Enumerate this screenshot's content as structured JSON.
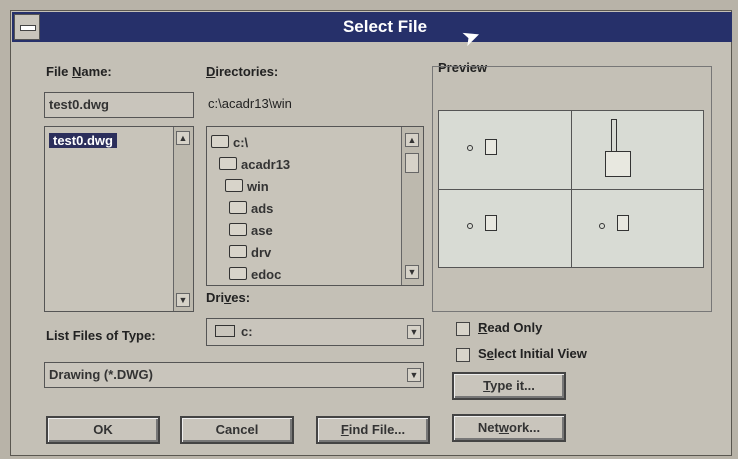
{
  "window": {
    "title": "Select File"
  },
  "file_name": {
    "label_pre": "File ",
    "label_u": "N",
    "label_post": "ame:",
    "value": "test0.dwg",
    "list": [
      "test0.dwg"
    ]
  },
  "directories": {
    "label_u": "D",
    "label_post": "irectories:",
    "current": "c:\\acadr13\\win",
    "items": [
      "c:\\",
      "acadr13",
      "win",
      "ads",
      "ase",
      "drv",
      "edoc"
    ]
  },
  "drives": {
    "label_pre": "Dri",
    "label_u": "v",
    "label_post": "es:",
    "value": "c:"
  },
  "file_type": {
    "label": "List Files of Type:",
    "value": "Drawing (*.DWG)"
  },
  "preview": {
    "label": "Preview"
  },
  "options": {
    "read_only_u": "R",
    "read_only_post": "ead Only",
    "select_view_pre": "S",
    "select_view_u": "e",
    "select_view_post": "lect Initial View"
  },
  "buttons": {
    "type_it_u": "T",
    "type_it_post": "ype it...",
    "ok": "OK",
    "cancel": "Cancel",
    "find_u": "F",
    "find_post": "ind File...",
    "network_pre": "Net",
    "network_u": "w",
    "network_post": "ork..."
  },
  "colors": {
    "titlebar": "#26306a",
    "selection": "#2c2f5c"
  }
}
